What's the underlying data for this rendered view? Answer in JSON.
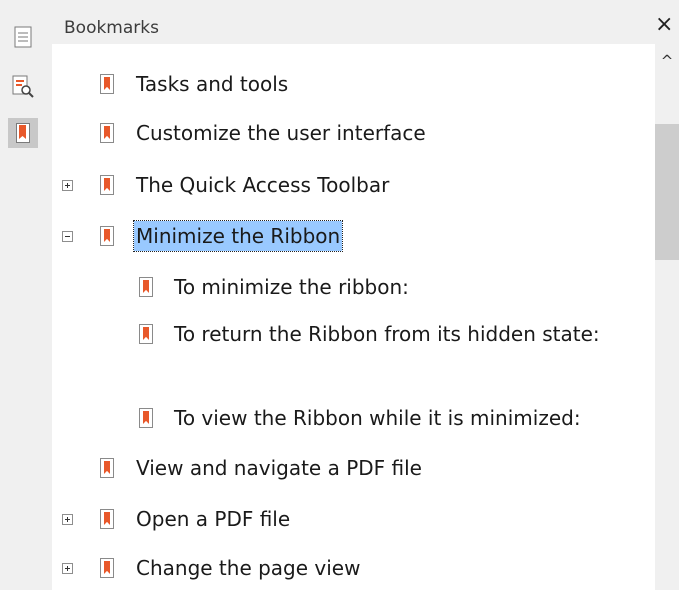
{
  "panel": {
    "title": "Bookmarks",
    "close_glyph": "×"
  },
  "sidebar": {
    "buttons": [
      {
        "icon": "page-thumbnails-icon",
        "active": false
      },
      {
        "icon": "search-document-icon",
        "active": false
      },
      {
        "icon": "bookmark-icon",
        "active": true
      }
    ]
  },
  "scrollbar": {
    "up_glyph": "^"
  },
  "bookmarks": [
    {
      "label": "Tasks and tools",
      "expander": "none",
      "level": 0
    },
    {
      "label": "Customize the user interface",
      "expander": "none",
      "level": 0
    },
    {
      "label": "The Quick Access Toolbar",
      "expander": "plus",
      "level": 0
    },
    {
      "label": "Minimize the Ribbon",
      "expander": "minus",
      "level": 0,
      "selected": true
    },
    {
      "label": "To minimize the ribbon:",
      "expander": "none",
      "level": 1
    },
    {
      "label": "To return the Ribbon from its hidden state:",
      "expander": "none",
      "level": 1
    },
    {
      "label": "To view the Ribbon while it is minimized:",
      "expander": "none",
      "level": 1
    },
    {
      "label": "View and navigate a PDF file",
      "expander": "none",
      "level": 0
    },
    {
      "label": "Open a PDF file",
      "expander": "plus",
      "level": 0
    },
    {
      "label": "Change the page view",
      "expander": "plus",
      "level": 0
    }
  ],
  "colors": {
    "bookmark_accent": "#e8582a",
    "selection": "#99c9ff"
  }
}
